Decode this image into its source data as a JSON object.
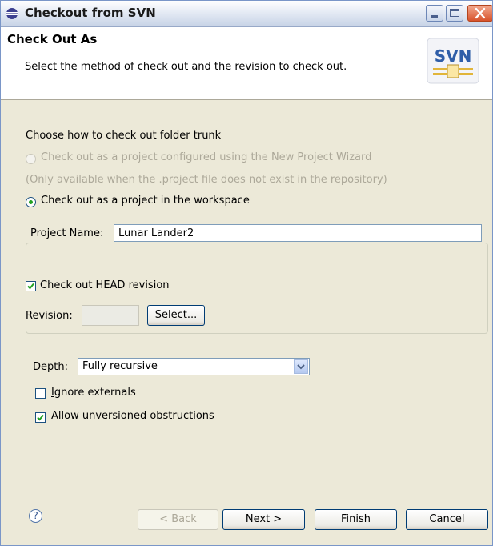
{
  "window": {
    "title": "Checkout from SVN",
    "controls": [
      "minimize-icon",
      "maximize-icon",
      "close-icon"
    ]
  },
  "header": {
    "title": "Check Out As",
    "description": "Select the method of check out and the revision to check out.",
    "logo_text": "SVN"
  },
  "options": {
    "prompt": "Choose how to check out folder trunk",
    "radio_wizard_label": "Check out as a project configured using the New Project Wizard",
    "wizard_note": "(Only available when the .project file does not exist in the repository)",
    "radio_workspace_label": "Check out as a project in the workspace",
    "selected": "workspace"
  },
  "project": {
    "label": "Project Name:",
    "value": "Lunar Lander2"
  },
  "revision": {
    "head_checkbox_label": "Check out HEAD revision",
    "head_checked": true,
    "label": "Revision:",
    "value": "",
    "select_button": "Select..."
  },
  "depth": {
    "label_prefix": "D",
    "label_rest": "epth:",
    "value": "Fully recursive",
    "ignore_externals_prefix": "I",
    "ignore_externals_rest": "gnore externals",
    "ignore_externals_checked": false,
    "allow_unversioned_prefix": "A",
    "allow_unversioned_rest": "llow unversioned obstructions",
    "allow_unversioned_checked": true
  },
  "footer": {
    "help_symbol": "?",
    "back_label": "< Back",
    "next_label": "Next >",
    "finish_label": "Finish",
    "cancel_label": "Cancel"
  },
  "colors": {
    "window_bg": "#ece9d8",
    "header_bg": "#ffffff",
    "accent": "#003c74",
    "radio_dot": "#21a121",
    "check_mark": "#21a121"
  }
}
